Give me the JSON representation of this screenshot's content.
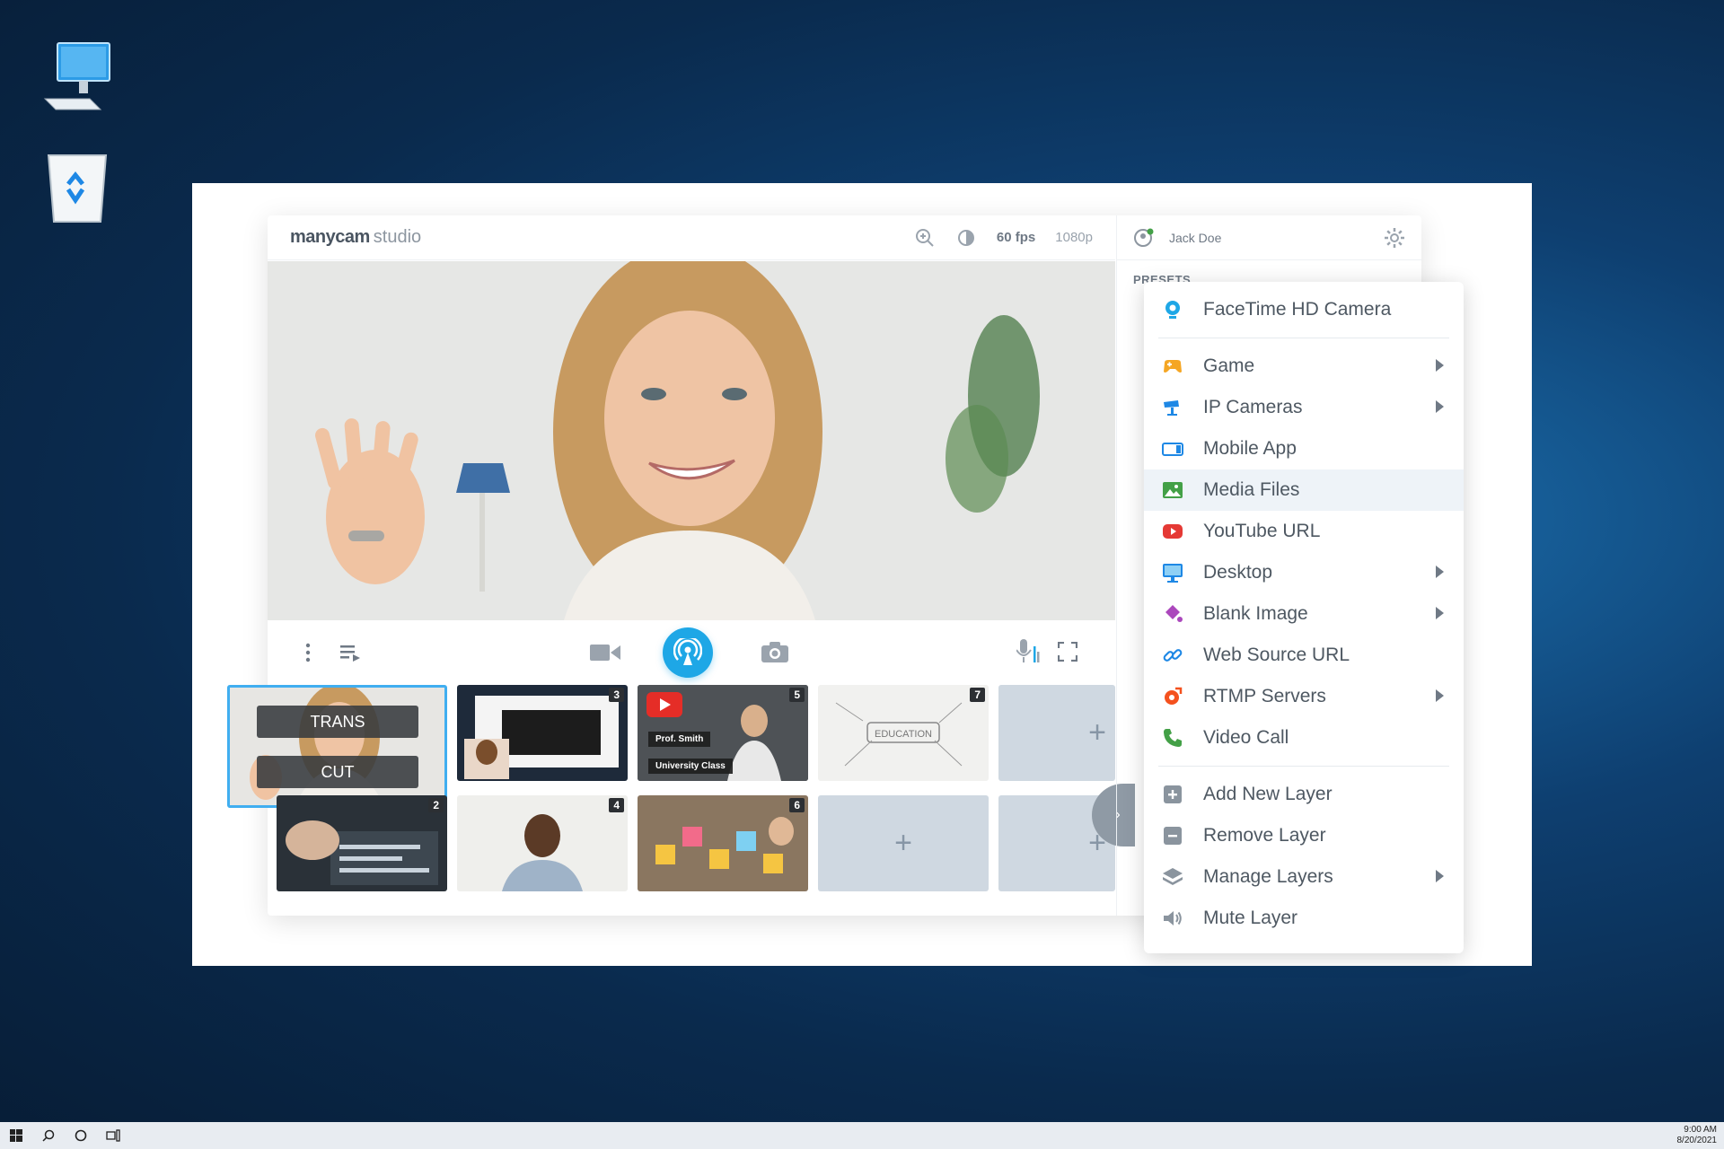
{
  "desktop": {
    "icons": [
      {
        "name": "This PC"
      },
      {
        "name": "Recycle Bin"
      }
    ]
  },
  "app": {
    "brand_bold": "manycam",
    "brand_light": "studio",
    "fps": "60 fps",
    "resolution": "1080p",
    "user_name": "Jack Doe",
    "presets_label": "PRESETS",
    "trans_label": "TRANS",
    "cut_label": "CUT",
    "thumb_texts": {
      "prof": "Prof. Smith",
      "class": "University Class",
      "education": "EDUCATION"
    },
    "thumbnails": [
      {
        "num": "3"
      },
      {
        "num": "5"
      },
      {
        "num": "7"
      },
      {
        "num": "2"
      },
      {
        "num": "4"
      },
      {
        "num": "6"
      }
    ],
    "add_symbol": "+"
  },
  "menu": {
    "items": [
      {
        "label": "FaceTime HD Camera",
        "icon": "webcam-icon",
        "color": "#1ea7e6"
      },
      {
        "label": "Game",
        "icon": "gamepad-icon",
        "color": "#f5a623",
        "submenu": true
      },
      {
        "label": "IP Cameras",
        "icon": "cctv-icon",
        "color": "#1e88e5",
        "submenu": true
      },
      {
        "label": "Mobile App",
        "icon": "mobile-icon",
        "color": "#1e88e5"
      },
      {
        "label": "Media Files",
        "icon": "image-icon",
        "color": "#43a047",
        "highlighted": true
      },
      {
        "label": "YouTube URL",
        "icon": "youtube-icon",
        "color": "#e53935"
      },
      {
        "label": "Desktop",
        "icon": "monitor-icon",
        "color": "#1e88e5",
        "submenu": true
      },
      {
        "label": "Blank Image",
        "icon": "paint-bucket-icon",
        "color": "#ab47bc",
        "submenu": true
      },
      {
        "label": "Web Source URL",
        "icon": "link-icon",
        "color": "#1e88e5"
      },
      {
        "label": "RTMP Servers",
        "icon": "rtmp-icon",
        "color": "#f4511e",
        "submenu": true
      },
      {
        "label": "Video Call",
        "icon": "phone-icon",
        "color": "#43a047"
      },
      {
        "label": "Add New Layer",
        "icon": "add-layer-icon",
        "color": "#8a949e"
      },
      {
        "label": "Remove Layer",
        "icon": "remove-layer-icon",
        "color": "#8a949e"
      },
      {
        "label": "Manage Layers",
        "icon": "layers-icon",
        "color": "#8a949e",
        "submenu": true
      },
      {
        "label": "Mute Layer",
        "icon": "speaker-icon",
        "color": "#8a949e"
      }
    ]
  },
  "taskbar": {
    "time": "9:00 AM",
    "date": "8/20/2021"
  }
}
